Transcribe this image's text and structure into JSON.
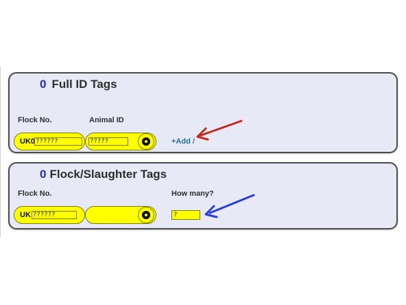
{
  "full_id": {
    "count": "0",
    "title": "Full ID Tags",
    "flock_label": "Flock No.",
    "animal_label": "Animal ID",
    "prefix": "UK0",
    "flock_value": "??????",
    "animal_value": "?????",
    "add_label": "+Add",
    "slash": "/"
  },
  "flock_slaughter": {
    "count": "0",
    "title": "Flock/Slaughter Tags",
    "flock_label": "Flock No.",
    "prefix": "UK",
    "flock_value": "??????",
    "how_many_label": "How many?",
    "how_many_value": "?"
  },
  "colors": {
    "panel_bg": "#e8e9f6",
    "tag_yellow": "#ffff00",
    "count_blue": "#1f2cc4",
    "red_arrow": "#c02a1e",
    "blue_arrow": "#2a3fd0"
  },
  "icons": [
    "tag-hole-icon",
    "red-arrow-icon",
    "blue-arrow-icon"
  ]
}
